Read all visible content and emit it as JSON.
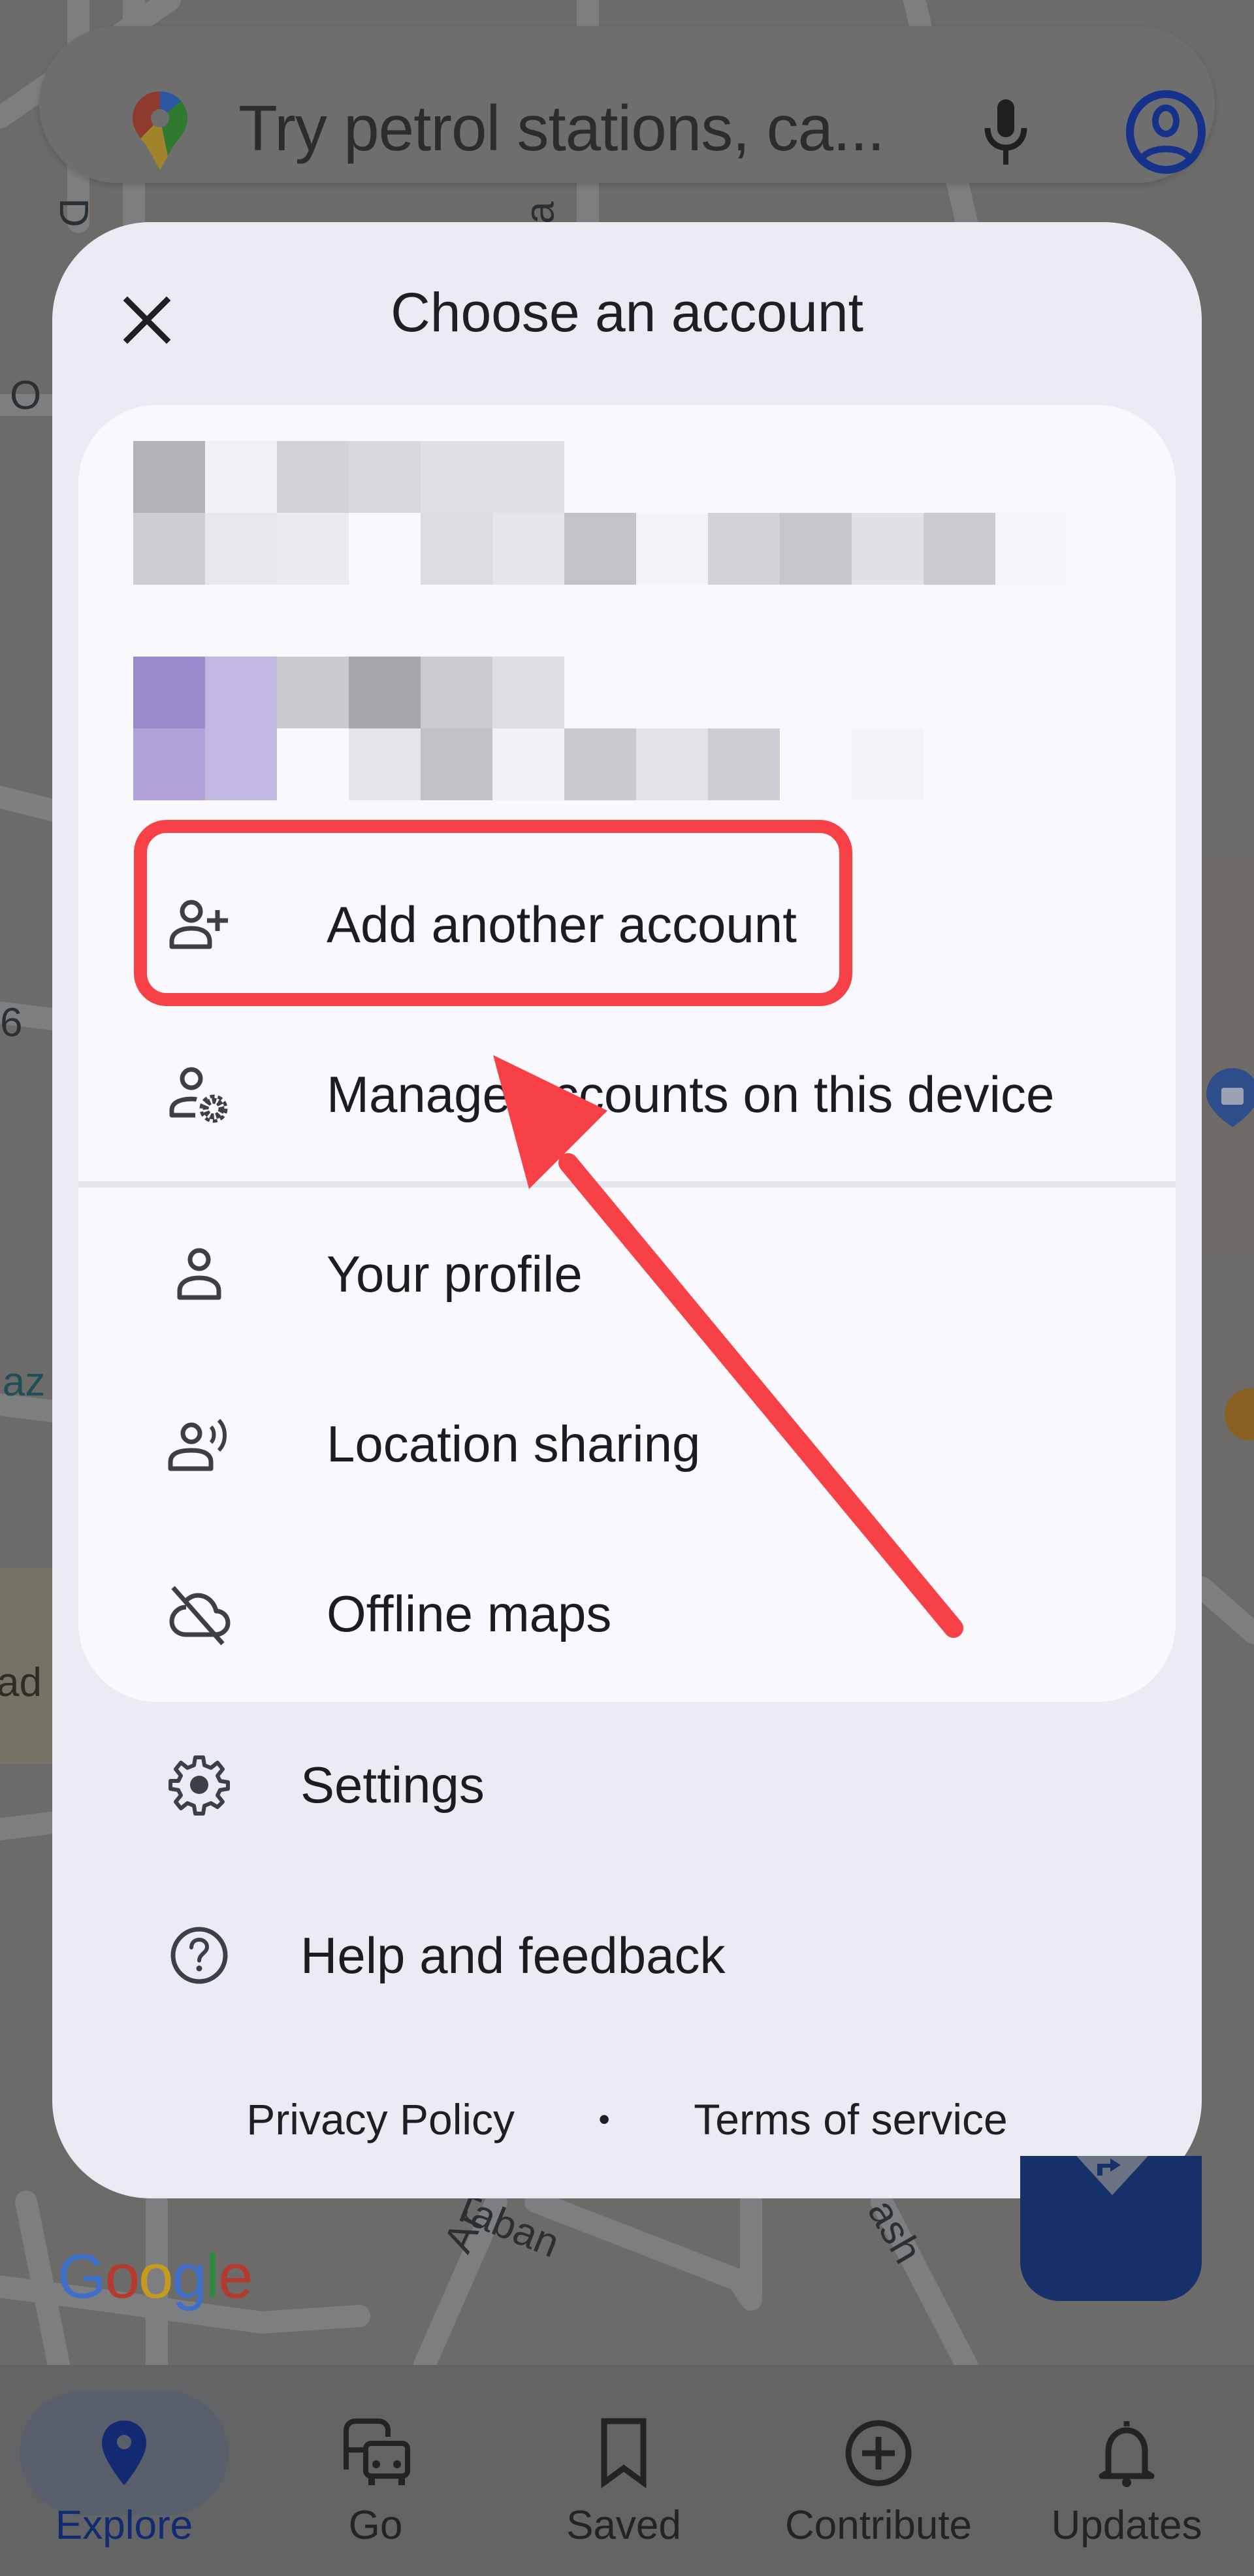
{
  "search": {
    "placeholder": "Try petrol stations, ca...",
    "icons": {
      "logo": "google-maps-pin-icon",
      "mic": "microphone-icon",
      "account": "account-circle-icon"
    }
  },
  "modal": {
    "title": "Choose an account",
    "close_icon": "close-icon",
    "accounts": [
      {
        "name": "[redacted]",
        "email": "[redacted]"
      },
      {
        "name": "[redacted]",
        "email": "[redacted]"
      }
    ],
    "card_items": [
      {
        "label": "Add another account",
        "icon": "person-add-icon",
        "highlighted": true
      },
      {
        "label": "Manage accounts on this device",
        "icon": "manage-accounts-icon"
      },
      {
        "label": "Your profile",
        "icon": "person-icon"
      },
      {
        "label": "Location sharing",
        "icon": "location-sharing-icon"
      },
      {
        "label": "Offline maps",
        "icon": "cloud-off-icon"
      }
    ],
    "outer_items": [
      {
        "label": "Settings",
        "icon": "gear-icon"
      },
      {
        "label": "Help and feedback",
        "icon": "help-icon"
      }
    ],
    "footer": {
      "privacy": "Privacy Policy",
      "separator": "•",
      "terms": "Terms of service"
    }
  },
  "map": {
    "labels": [
      "Taban",
      "ash",
      "Ar",
      "laz",
      "ad",
      "O",
      "6",
      "D",
      "a"
    ],
    "brand": "Google"
  },
  "annotation": {
    "target": "Add another account",
    "color": "#f74147"
  },
  "bottom_nav": {
    "items": [
      {
        "label": "Explore",
        "icon": "location-pin-icon",
        "active": true
      },
      {
        "label": "Go",
        "icon": "commute-icon",
        "active": false
      },
      {
        "label": "Saved",
        "icon": "bookmark-icon",
        "active": false
      },
      {
        "label": "Contribute",
        "icon": "add-circle-icon",
        "active": false
      },
      {
        "label": "Updates",
        "icon": "bell-icon",
        "active": false
      }
    ]
  },
  "colors": {
    "accent": "#112a72",
    "fab": "#163069",
    "modal_bg": "#ebecf3",
    "card_bg": "#f8f8fd",
    "annotation_red": "#f74147"
  }
}
